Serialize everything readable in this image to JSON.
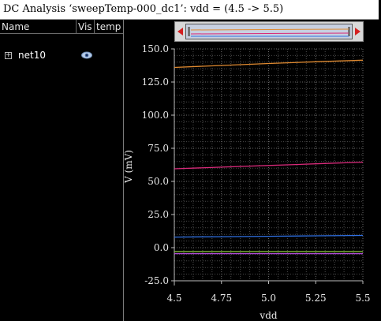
{
  "window": {
    "title": "DC Analysis ‘sweepTemp-000_dc1’: vdd = (4.5 -> 5.5)"
  },
  "sidebar": {
    "columns": [
      "Name",
      "Vis",
      "temp"
    ],
    "signals": [
      {
        "name": "net10",
        "expander": "+",
        "visible": true,
        "icon": "eye-icon"
      }
    ]
  },
  "overview": {
    "left_arrow_icon": "arrow-left-icon",
    "right_arrow_icon": "arrow-right-icon"
  },
  "chart_data": {
    "type": "line",
    "xlabel": "vdd",
    "ylabel": "V (mV)",
    "xlim": [
      4.5,
      5.5
    ],
    "ylim": [
      -25.0,
      150.0
    ],
    "xticks": [
      4.5,
      4.75,
      5.0,
      5.25,
      5.5
    ],
    "xtick_labels": [
      "4.5",
      "4.75",
      "5.0",
      "5.25",
      "5.5"
    ],
    "yticks": [
      -25.0,
      0.0,
      25.0,
      50.0,
      75.0,
      100.0,
      125.0,
      150.0
    ],
    "ytick_labels": [
      "-25.0",
      "0.0",
      "25.0",
      "50.0",
      "75.0",
      "100.0",
      "125.0",
      "150.0"
    ],
    "grid": true,
    "x": [
      4.5,
      4.75,
      5.0,
      5.25,
      5.5
    ],
    "series": [
      {
        "color": "#e08a30",
        "values": [
          136.0,
          137.5,
          139.0,
          140.3,
          141.5
        ]
      },
      {
        "color": "#d82a7a",
        "values": [
          59.5,
          60.8,
          62.0,
          63.3,
          64.5
        ]
      },
      {
        "color": "#2f6fe0",
        "values": [
          8.0,
          8.3,
          8.6,
          8.9,
          9.2
        ]
      },
      {
        "color": "#90d040",
        "values": [
          -3.0,
          -3.0,
          -3.0,
          -3.0,
          -3.0
        ]
      },
      {
        "color": "#b04ad8",
        "values": [
          -4.5,
          -4.5,
          -4.5,
          -4.5,
          -4.5
        ]
      }
    ]
  }
}
